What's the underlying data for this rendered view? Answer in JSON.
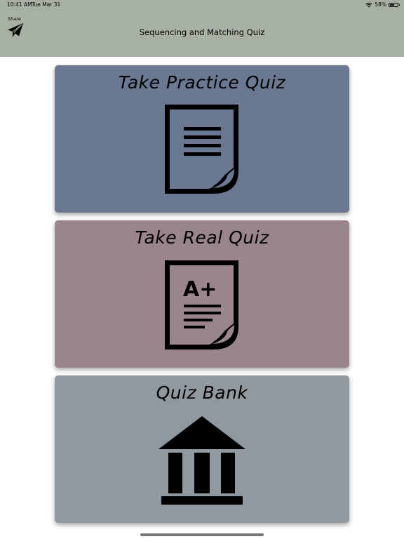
{
  "status_bar": {
    "time": "10:41 AM",
    "date": "Tue Mar 31",
    "battery": "58%",
    "battery_level": 0.58
  },
  "header": {
    "share_label": "Share",
    "title": "Sequencing and Matching Quiz"
  },
  "cards": [
    {
      "title": "Take Practice Quiz",
      "icon": "document-lines-icon",
      "color": "#6b7891"
    },
    {
      "title": "Take Real Quiz",
      "icon": "graded-document-icon",
      "color": "#9a858c",
      "grade": "A+"
    },
    {
      "title": "Quiz Bank",
      "icon": "bank-building-icon",
      "color": "#9199a0"
    }
  ],
  "colors": {
    "header": "#a6b0a3",
    "background": "#ffffff"
  }
}
